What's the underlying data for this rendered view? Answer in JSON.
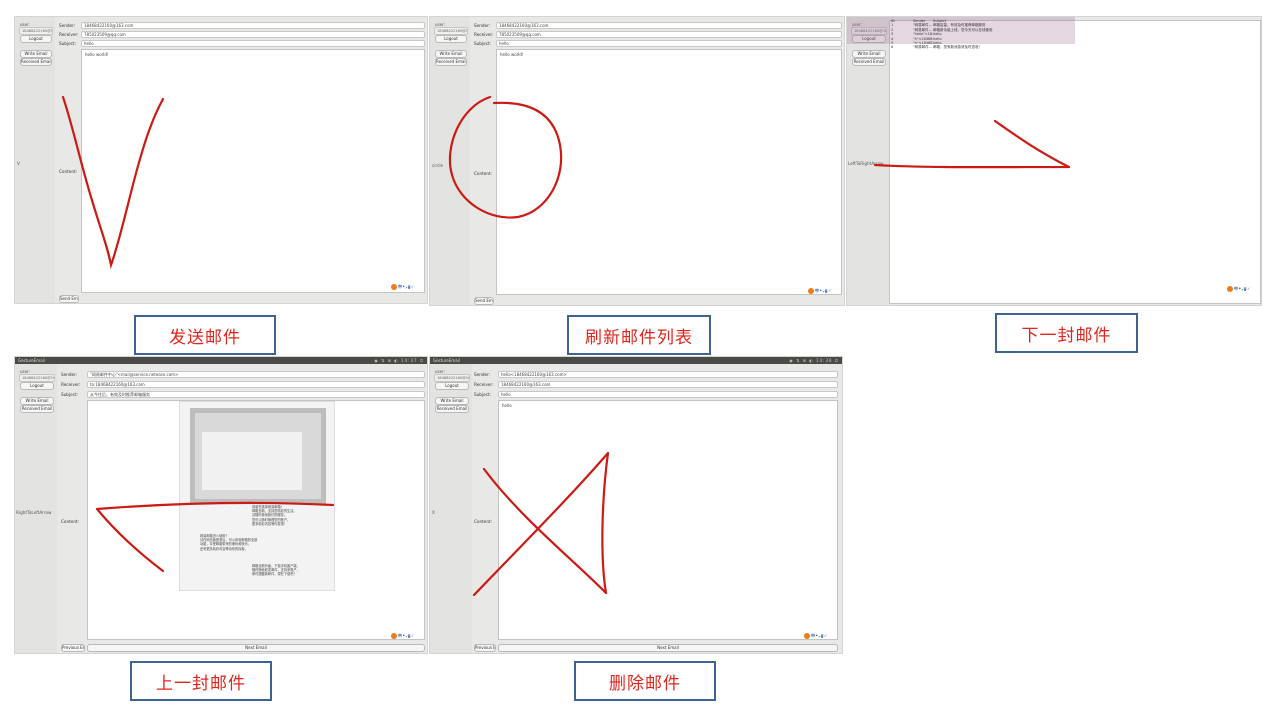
{
  "app": {
    "user_label": "user:",
    "user_value": "18468422160@163.com",
    "logout_label": "Logout",
    "write_label": "Write Email",
    "received_label": "Received Email"
  },
  "labels": {
    "sender": "Sender:",
    "receiver": "Receiver:",
    "subject": "Subject:",
    "content": "Content:",
    "send_button": "Send Email",
    "previous_button": "Previous Email",
    "next_button": "Next Email",
    "window_title": "GestureEmail"
  },
  "panels": {
    "p1": {
      "caption": "发送邮件",
      "gesture_label": "V",
      "sender": "18468422160@163.com",
      "receiver": "785023509@qq.com",
      "subject": "hello",
      "content": "hello world!"
    },
    "p2": {
      "caption": "刷新邮件列表",
      "gesture_label": "circle",
      "sender": "18468422160@163.com",
      "receiver": "785023509@qq.com",
      "subject": "hello",
      "content": "hello world!"
    },
    "p3": {
      "caption": "下一封邮件",
      "gesture_label": "LeftToRightArrow",
      "columns": [
        "ID",
        "Sender",
        "Subject"
      ],
      "rows": [
        [
          "1",
          "\"网易邮件...",
          "邮箱容量，有效及时推荐邮箱服务"
        ],
        [
          "2",
          "\"网易邮件...",
          "邮箱新功能上线，您今天可以在线使用"
        ],
        [
          "3",
          "\"hello\"<18...",
          "hello"
        ],
        [
          "4",
          "\"h\"<18468...",
          "hello"
        ],
        [
          "5",
          "\"h\"<18468...",
          "hello"
        ],
        [
          "6",
          "\"网易邮件...",
          "邮箱，您有新消息请及时查收！"
        ]
      ]
    },
    "p4": {
      "caption": "上一封邮件",
      "gesture_label": "RightToLeftArrow",
      "sender": "\"网易邮件中心\"<mail@service.netease.com>",
      "receiver": "to:18468422160@163.com",
      "subject": "从今往后，有效及时推荐邮箱服务",
      "body_paragraph_1": "感谢您选择网易邮箱！\n邮箱全新，支持您精彩的生活，\n请随时使用我们的服务，\n您可以随时管理您的账户，\n更多精彩内容等你发现！",
      "body_paragraph_2": "网易邮箱怎么使用？\n请在网页版登录后，可以体验邮箱的全部\n功能，享受邮箱带来的便利和快乐，\n还有更多精彩内容等待你的探索。",
      "body_paragraph_3": "邮箱全新升级，下载手机客户端，\n随时随地收发邮件，支持多账户，\n即时提醒新邮件，现在下载吧！"
    },
    "p5": {
      "caption": "删除邮件",
      "gesture_label": "X",
      "sender": "hello<18468422160@163.com>",
      "receiver": "18468422160@163.com",
      "subject": "hello",
      "content": "hello"
    }
  },
  "colors": {
    "stroke": "#cc1a14",
    "caption_border": "#3d6495",
    "caption_text": "#e0261c"
  }
}
